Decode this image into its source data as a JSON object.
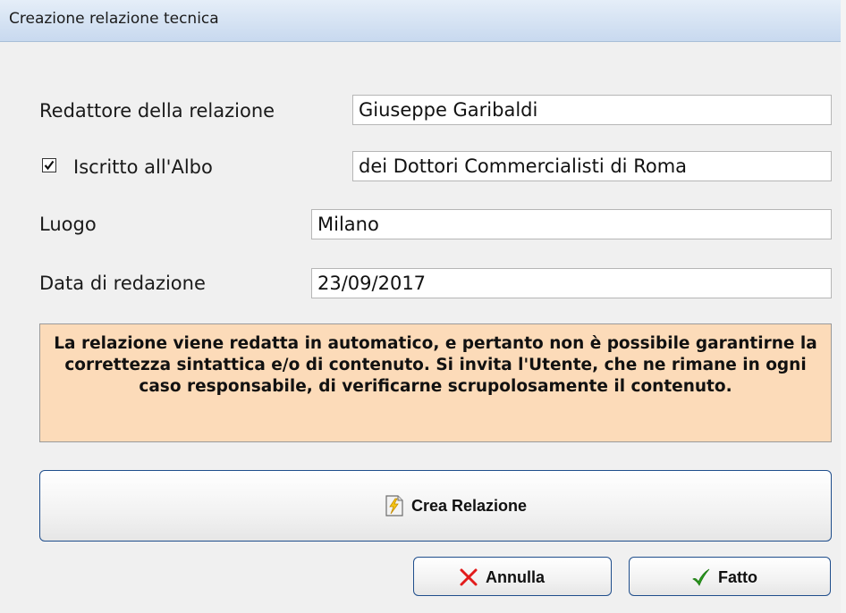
{
  "window": {
    "title": "Creazione relazione tecnica"
  },
  "form": {
    "redattore_label": "Redattore della relazione",
    "redattore_value": "Giuseppe Garibaldi",
    "albo_label": "Iscritto all'Albo",
    "albo_checked": true,
    "albo_value": "dei Dottori Commercialisti di Roma",
    "luogo_label": "Luogo",
    "luogo_value": "Milano",
    "data_label": "Data di redazione",
    "data_value": "23/09/2017"
  },
  "notice": {
    "text": "La relazione viene redatta in automatico, e pertanto non è possibile garantirne la correttezza sintattica e/o di contenuto. Si invita l'Utente, che ne rimane in ogni caso responsabile, di verificarne scrupolosamente il contenuto.",
    "background": "#fcdbb9"
  },
  "buttons": {
    "crea_label": "Crea Relazione",
    "crea_icon": "document-lightning-icon",
    "annulla_label": "Annulla",
    "annulla_icon": "red-x-icon",
    "fatto_label": "Fatto",
    "fatto_icon": "green-check-icon"
  },
  "colors": {
    "button_border": "#1f4e8c",
    "cancel_icon": "#e21b1b",
    "ok_icon": "#2a9a1e"
  }
}
